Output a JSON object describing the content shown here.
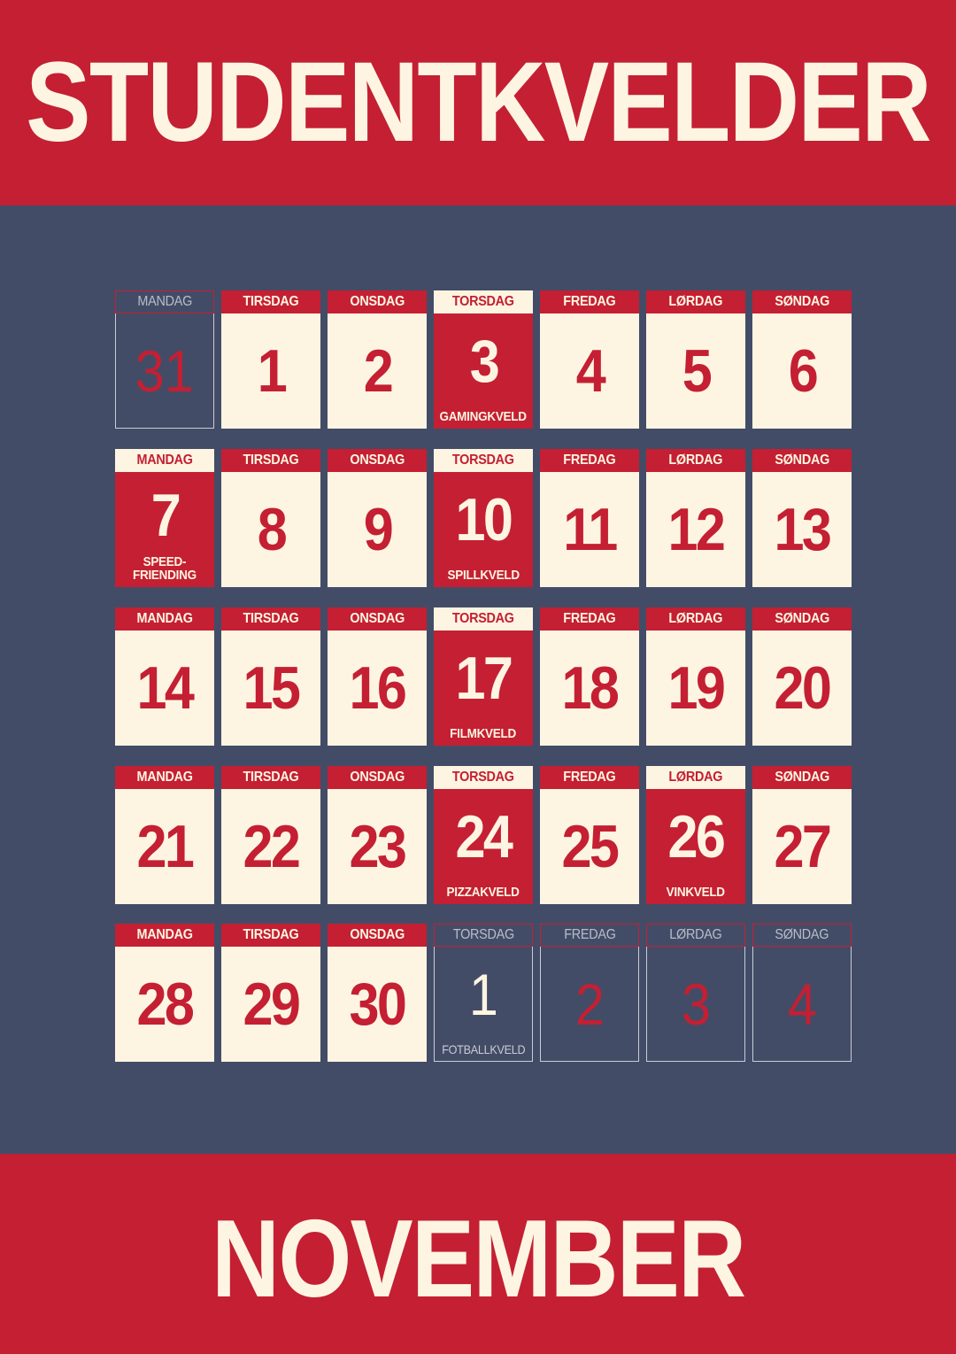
{
  "header": {
    "title": "STUDENTKVELDER"
  },
  "footer": {
    "title": "NOVEMBER"
  },
  "colors": {
    "red": "#c41f33",
    "cream": "#fdf5e1",
    "navy": "#434c67"
  },
  "weeks": [
    [
      {
        "day": "MANDAG",
        "num": "31",
        "style": "outside"
      },
      {
        "day": "TIRSDAG",
        "num": "1"
      },
      {
        "day": "ONSDAG",
        "num": "2"
      },
      {
        "day": "TORSDAG",
        "num": "3",
        "style": "event",
        "event": "GAMINGKVELD"
      },
      {
        "day": "FREDAG",
        "num": "4"
      },
      {
        "day": "LØRDAG",
        "num": "5"
      },
      {
        "day": "SØNDAG",
        "num": "6"
      }
    ],
    [
      {
        "day": "MANDAG",
        "num": "7",
        "style": "event",
        "event": "SPEED-\nFRIENDING"
      },
      {
        "day": "TIRSDAG",
        "num": "8"
      },
      {
        "day": "ONSDAG",
        "num": "9"
      },
      {
        "day": "TORSDAG",
        "num": "10",
        "style": "event",
        "event": "SPILLKVELD"
      },
      {
        "day": "FREDAG",
        "num": "11"
      },
      {
        "day": "LØRDAG",
        "num": "12"
      },
      {
        "day": "SØNDAG",
        "num": "13"
      }
    ],
    [
      {
        "day": "MANDAG",
        "num": "14"
      },
      {
        "day": "TIRSDAG",
        "num": "15"
      },
      {
        "day": "ONSDAG",
        "num": "16"
      },
      {
        "day": "TORSDAG",
        "num": "17",
        "style": "event",
        "event": "FILMKVELD"
      },
      {
        "day": "FREDAG",
        "num": "18"
      },
      {
        "day": "LØRDAG",
        "num": "19"
      },
      {
        "day": "SØNDAG",
        "num": "20"
      }
    ],
    [
      {
        "day": "MANDAG",
        "num": "21"
      },
      {
        "day": "TIRSDAG",
        "num": "22"
      },
      {
        "day": "ONSDAG",
        "num": "23"
      },
      {
        "day": "TORSDAG",
        "num": "24",
        "style": "event",
        "event": "PIZZAKVELD"
      },
      {
        "day": "FREDAG",
        "num": "25"
      },
      {
        "day": "LØRDAG",
        "num": "26",
        "style": "event",
        "event": "VINKVELD"
      },
      {
        "day": "SØNDAG",
        "num": "27"
      }
    ],
    [
      {
        "day": "MANDAG",
        "num": "28"
      },
      {
        "day": "TIRSDAG",
        "num": "29"
      },
      {
        "day": "ONSDAG",
        "num": "30"
      },
      {
        "day": "TORSDAG",
        "num": "1",
        "style": "outside-event",
        "event": "FOTBALLKVELD"
      },
      {
        "day": "FREDAG",
        "num": "2",
        "style": "outside"
      },
      {
        "day": "LØRDAG",
        "num": "3",
        "style": "outside"
      },
      {
        "day": "SØNDAG",
        "num": "4",
        "style": "outside"
      }
    ]
  ]
}
